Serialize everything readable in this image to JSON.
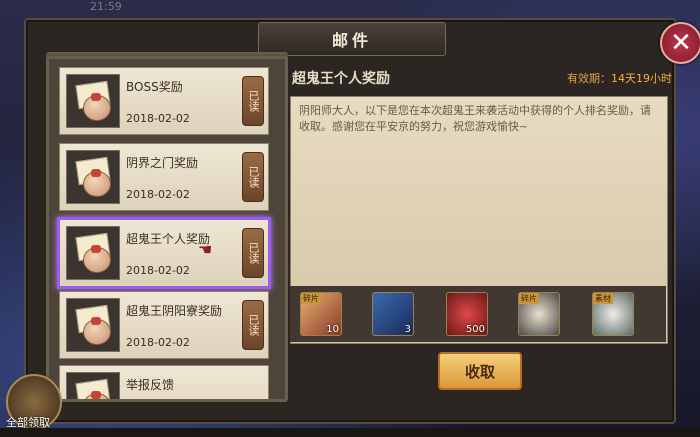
{
  "window": {
    "title": "邮件"
  },
  "top_partial_text": "21:59",
  "mails": [
    {
      "title": "BOSS奖励",
      "date": "2018-02-02",
      "status": "已读"
    },
    {
      "title": "阴界之门奖励",
      "date": "2018-02-02",
      "status": "已读"
    },
    {
      "title": "超鬼王个人奖励",
      "date": "2018-02-02",
      "status": "已读",
      "selected": true
    },
    {
      "title": "超鬼王阴阳寮奖励",
      "date": "2018-02-02",
      "status": "已读"
    },
    {
      "title": "举报反馈",
      "date": "",
      "status": ""
    }
  ],
  "detail": {
    "title": "超鬼王个人奖励",
    "validity_label": "有效期：",
    "validity_value": "14天19小时",
    "body": "阴阳师大人，以下是您在本次超鬼王来袭活动中获得的个人排名奖励，请收取。感谢您在平安京的努力，祝您游戏愉快~",
    "rewards": [
      {
        "icon": "character-shard-icon",
        "badge": "碎片",
        "count": "10"
      },
      {
        "icon": "blue-scroll-icon",
        "badge": "",
        "count": "3"
      },
      {
        "icon": "red-magatama-icon",
        "badge": "",
        "count": "500"
      },
      {
        "icon": "daruma-shard-icon",
        "badge": "碎片",
        "count": ""
      },
      {
        "icon": "daruma-material-icon",
        "badge": "素材",
        "count": ""
      }
    ],
    "collect_label": "收取"
  },
  "collect_all_label": "全部领取",
  "colors": {
    "selected_border": "#9d5cf0",
    "validity": "#e3a24a",
    "close": "#c0354a"
  }
}
